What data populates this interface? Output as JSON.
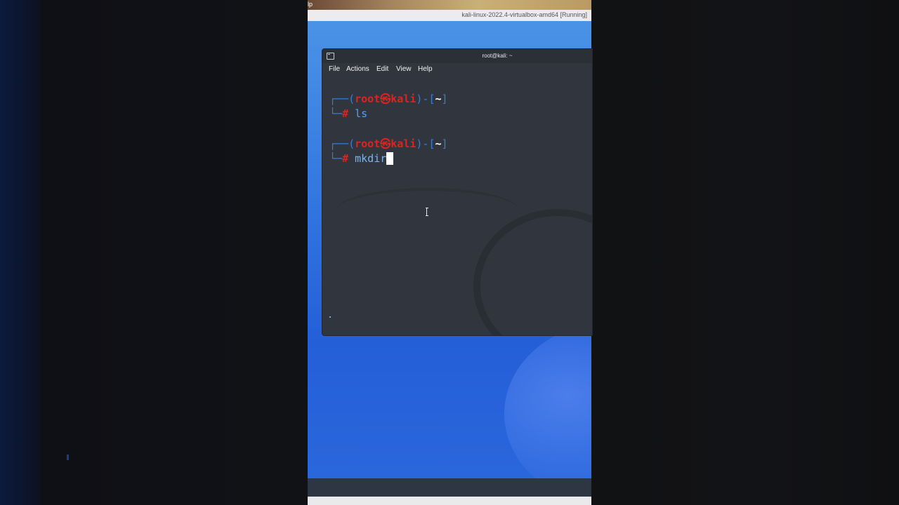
{
  "vm_window": {
    "top_label": "lp",
    "title": "kali-linux-2022.4-virtualbox-amd64 [Running]"
  },
  "terminal": {
    "title": "root@kali: ~",
    "menu": [
      "File",
      "Actions",
      "Edit",
      "View",
      "Help"
    ],
    "prompts": [
      {
        "open_bracket": "┌──(",
        "user": "root",
        "at": "㉿",
        "host": "kali",
        "mid": ")-[",
        "dir": "~",
        "close": "]",
        "hash_prefix": "└─",
        "hash": "#",
        "command": "ls"
      },
      {
        "open_bracket": "┌──(",
        "user": "root",
        "at": "㉿",
        "host": "kali",
        "mid": ")-[",
        "dir": "~",
        "close": "]",
        "hash_prefix": "└─",
        "hash": "#",
        "command": "mkdir"
      }
    ]
  },
  "colors": {
    "prompt_blue": "#3a7bd5",
    "prompt_red": "#e0221f",
    "terminal_bg": "#31363e",
    "desktop_blue": "#2f72df"
  }
}
